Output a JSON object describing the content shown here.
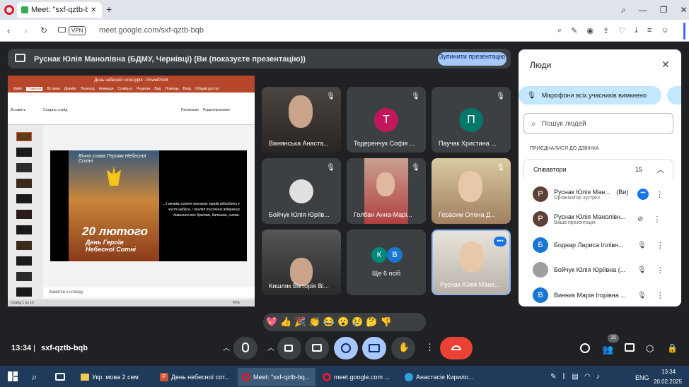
{
  "browser": {
    "tab_title": "Meet: \"sxf-qztb-bq",
    "url": "meet.google.com/sxf-qztb-bqb",
    "vpn": "VPN",
    "new_tab": "+"
  },
  "banner": {
    "text": "Руснак Юлія Манолівна (БДМУ, Чернівці) (Ви (показуєте презентацію))",
    "stop": "Зупинити презентацію"
  },
  "ppt": {
    "title": "День небесної сотні.pptx - PowerPoint",
    "menu": [
      "Файл",
      "Главная",
      "Вставка",
      "Дизайн",
      "Переход",
      "Анимаци",
      "Слайд-ш",
      "Рецензи",
      "Вид",
      "Помощь",
      "Вход",
      "Общий доступ"
    ],
    "paste": "Вставить",
    "create": "Создать слайд",
    "draw": "Рисование",
    "edit": "Редактирование",
    "notes": "Заметки к слайду",
    "status": "Слайд 1 из 16",
    "zoom": "45%",
    "slide_title": "Вічна слава Героям Небесної Сотні",
    "slide_date": "20 лютого",
    "slide_day": "День Героїв Небесної Сотні",
    "quote": "...І мечами сотня незнаних героїв відходить у чисті небеса, і погляд тисячних відважних дивилися всіх братам, батькам, синам."
  },
  "tiles": [
    {
      "name": "Вікнянська Анаста...",
      "type": "photo"
    },
    {
      "name": "Тодеренчук Софія ...",
      "initial": "Т",
      "color": "#c2185b"
    },
    {
      "name": "Паучак Христина ...",
      "initial": "П",
      "color": "#00796b"
    },
    {
      "name": "Бойчук Юлія Юріїв...",
      "type": "avatar"
    },
    {
      "name": "Голбан Анна-Марі...",
      "type": "photo"
    },
    {
      "name": "Герасим Олена Д...",
      "type": "photo"
    },
    {
      "name": "Кишляк Вікторія Ві...",
      "type": "photo"
    },
    {
      "name": "Ще 6 осіб",
      "initials": [
        "К",
        "В"
      ]
    },
    {
      "name": "Руснак Юлія Мано...",
      "type": "photo"
    }
  ],
  "people": {
    "title": "Люди",
    "muted": "Мікрофони всіх учасників вимкнено",
    "search": "Пошук людей",
    "joined": "ПРИЄДНАЛИСЯ ДО ДЗВІНКА",
    "group": "Співавтори",
    "count": "15",
    "list": [
      {
        "initial": "Р",
        "color": "#5d4037",
        "name": "Руснак Юлія Ман...",
        "tag": "(Ви)",
        "sub": "Організатор зустрічі"
      },
      {
        "initial": "Р",
        "color": "#5d4037",
        "name": "Руснак Юлія Манолівн...",
        "sub": "Ваша презентація"
      },
      {
        "initial": "Б",
        "color": "#1976d2",
        "name": "Боднар Лариса Іллівн..."
      },
      {
        "initial": "",
        "color": "#9e9e9e",
        "name": "Бойчук Юлія Юріївна (..."
      },
      {
        "initial": "В",
        "color": "#1976d2",
        "name": "Винник Марія Ігорівна ..."
      }
    ]
  },
  "reactions": [
    "💖",
    "👍",
    "🎉",
    "👏",
    "😂",
    "😮",
    "😢",
    "🤔",
    "👎"
  ],
  "bottom": {
    "time": "13:34",
    "meeting": "sxf-qztb-bqb",
    "badge": "15"
  },
  "taskbar": {
    "items": [
      "Укр. мова 2 сем",
      "День небесної сот...",
      "Meet: \"sxf-qztb-bq...",
      "meet.google.com ...",
      "Анастасія Кирило..."
    ],
    "lang": "ENG",
    "time": "13:34",
    "date": "20.02.2025"
  }
}
